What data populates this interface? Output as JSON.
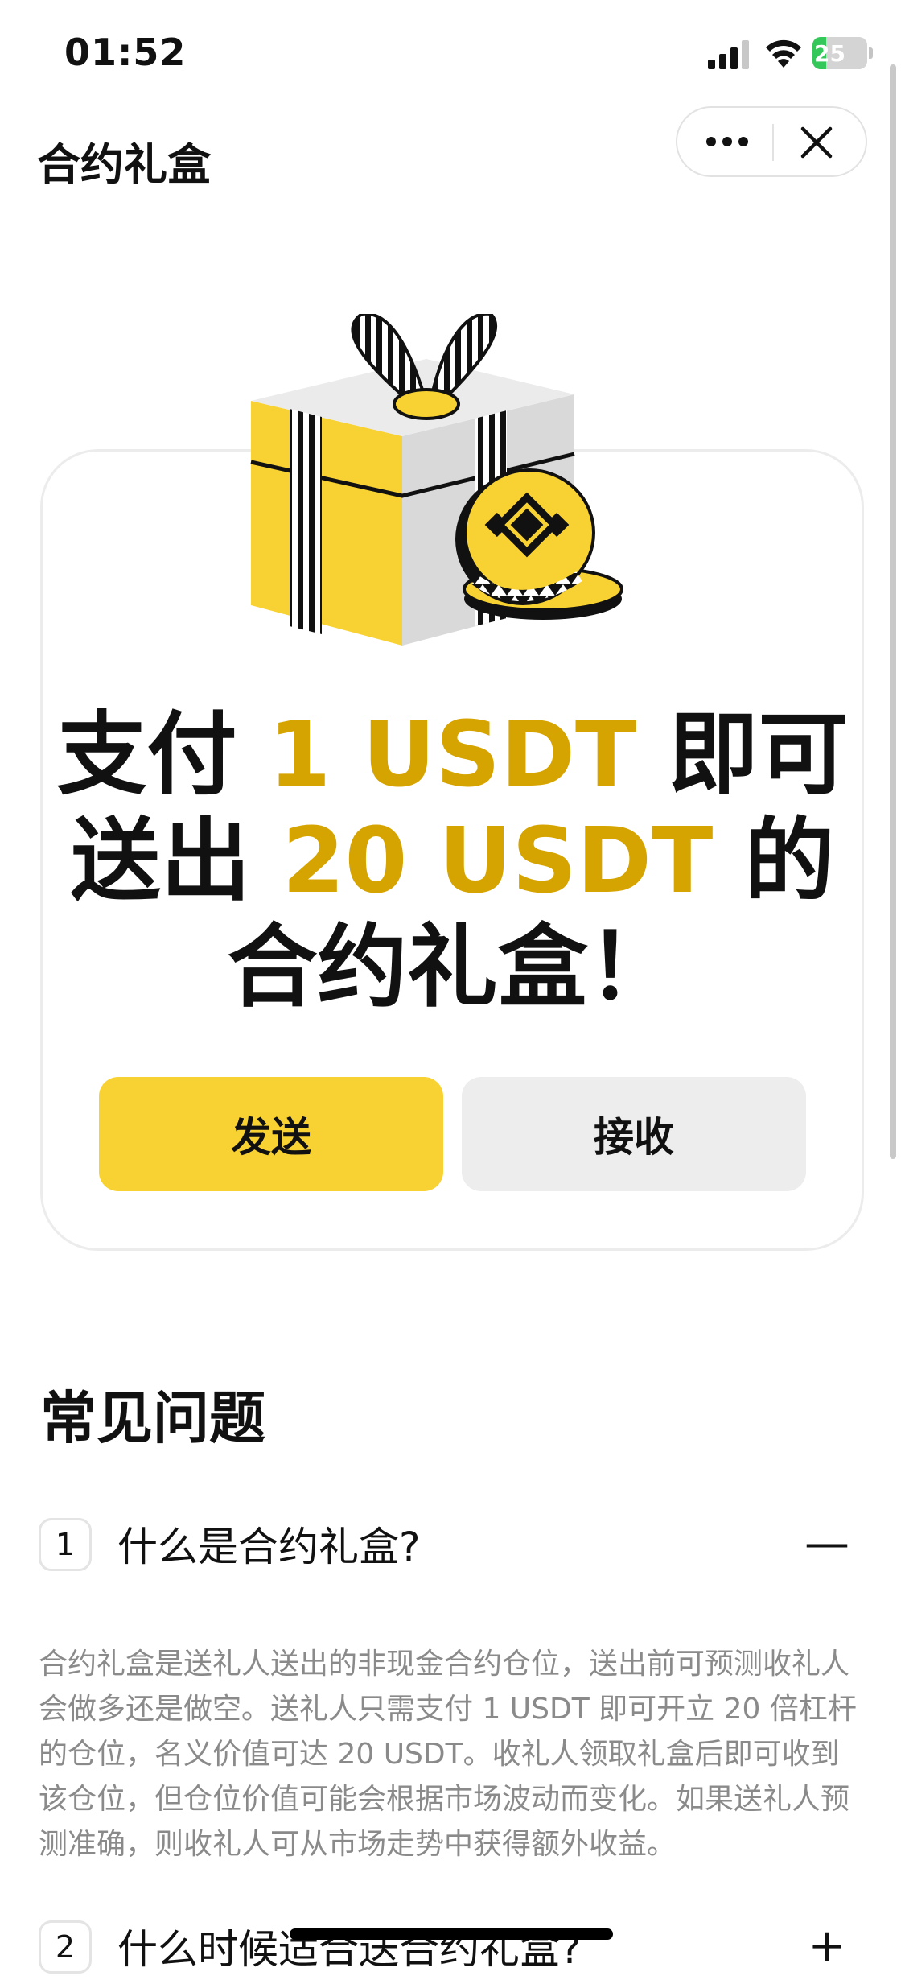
{
  "status_bar": {
    "time": "01:52",
    "battery": {
      "level_percent": 25,
      "label": "25",
      "charging": true,
      "color": "#34c759"
    }
  },
  "header": {
    "title": "合约礼盒",
    "more_icon": "more-dots-icon",
    "close_icon": "close-x-icon"
  },
  "hero": {
    "illustration": "gift-box-with-coins",
    "line1": {
      "pre": "支付 ",
      "amount": "1 USDT",
      "post": " 即可"
    },
    "line2": {
      "pre": "送出 ",
      "amount": "20 USDT",
      "post": " 的"
    },
    "line3": "合约礼盒！",
    "accent_color": "#d6a400"
  },
  "actions": {
    "send_label": "发送",
    "receive_label": "接收",
    "send_color": "#f8d233",
    "receive_color": "#ededed"
  },
  "faq": {
    "title": "常见问题",
    "items": [
      {
        "number": "1",
        "question": "什么是合约礼盒?",
        "toggle": "—",
        "expanded": true,
        "answer": "合约礼盒是送礼人送出的非现金合约仓位，送出前可预测收礼人会做多还是做空。送礼人只需支付 1 USDT 即可开立 20 倍杠杆的仓位，名义价值可达 20 USDT。收礼人领取礼盒后即可收到该仓位，但仓位价值可能会根据市场波动而变化。如果送礼人预测准确，则收礼人可从市场走势中获得额外收益。"
      },
      {
        "number": "2",
        "question": "什么时候适合送合约礼盒?",
        "toggle": "+",
        "expanded": false
      }
    ]
  }
}
